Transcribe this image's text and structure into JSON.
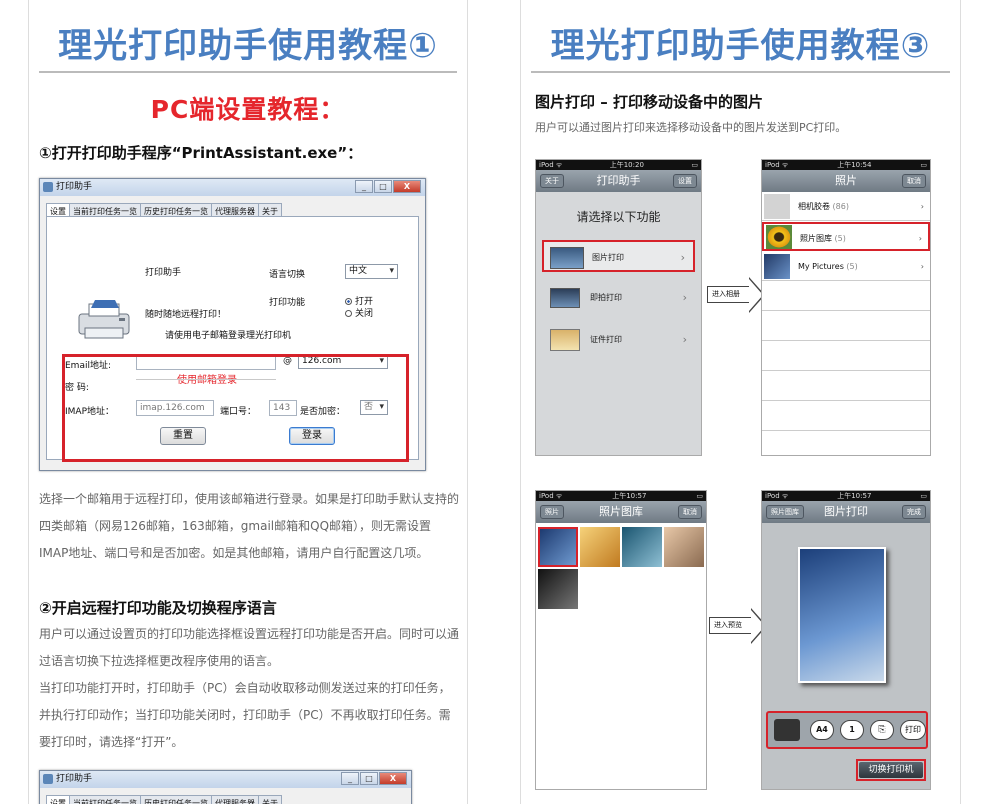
{
  "left": {
    "title": "理光打印助手使用教程①",
    "section_title": "PC端设置教程：",
    "step1": "①打开打印助手程序“PrintAssistant.exe”：",
    "dialog": {
      "window_title": "打印助手",
      "controls": [
        "_",
        "□",
        "X"
      ],
      "tabs": [
        "设置",
        "当前打印任务一览",
        "历史打印任务一览",
        "代理服务器",
        "关于"
      ],
      "app_name": "打印助手",
      "slogan": "随时随地远程打印！",
      "language_label": "语言切换",
      "language_value": "中文",
      "print_func_label": "打印功能",
      "radio_on": "打开",
      "radio_off": "关闭",
      "login_hint": "请使用电子邮箱登录理光打印机",
      "email_label": "Email地址:",
      "at": "@",
      "domain_value": "126.com",
      "annotation": "使用邮箱登录",
      "password_label": "密 码:",
      "imap_label": "IMAP地址：",
      "imap_value": "imap.126.com",
      "port_label": "端口号：",
      "port_value": "143",
      "encrypt_label": "是否加密：",
      "encrypt_value": "否",
      "reset_button": "重置",
      "login_button": "登录"
    },
    "para1": "选择一个邮箱用于远程打印，使用该邮箱进行登录。如果是打印助手默认支持的四类邮箱（网易126邮箱，163邮箱，gmail邮箱和QQ邮箱），则无需设置IMAP地址、端口号和是否加密。如是其他邮箱，请用户自行配置这几项。",
    "step2": "②开启远程打印功能及切换程序语言",
    "para2": "用户可以通过设置页的打印功能选择框设置远程打印功能是否开启。同时可以通过语言切换下拉选择框更改程序使用的语言。",
    "para3": "当打印功能打开时，打印助手（PC）会自动收取移动侧发送过来的打印任务，并执行打印动作；当打印功能关闭时，打印助手（PC）不再收取打印任务。需要打印时，请选择“打开”。",
    "dialog2": {
      "window_title": "打印助手",
      "controls": [
        "_",
        "□",
        "X"
      ],
      "tabs": [
        "设置",
        "当前打印任务一览",
        "历史打印任务一览",
        "代理服务器",
        "关于"
      ]
    }
  },
  "right": {
    "title": "理光打印助手使用教程③",
    "heading": "图片打印 – 打印移动设备中的图片",
    "desc": "用户可以通过图片打印来选择移动设备中的图片发送到PC打印。",
    "phone1": {
      "status_left": "iPod ᯤ",
      "status_time": "上午10:20",
      "nav_title": "打印助手",
      "nav_left": "关于",
      "nav_right": "设置",
      "prompt": "请选择以下功能",
      "items": [
        "图片打印",
        "即拍打印",
        "证件打印"
      ]
    },
    "arrow1": "进入相册",
    "phone2": {
      "status_left": "iPod ᯤ",
      "status_time": "上午10:54",
      "nav_title": "照片",
      "nav_right": "取消",
      "rows": [
        {
          "name": "相机胶卷",
          "count": "(86)"
        },
        {
          "name": "照片图库",
          "count": "(5)"
        },
        {
          "name": "My Pictures",
          "count": "(5)"
        }
      ]
    },
    "phone3": {
      "status_left": "iPod ᯤ",
      "status_time": "上午10:57",
      "nav_title": "照片图库",
      "nav_left": "照片",
      "nav_right": "取消"
    },
    "arrow2": "进入预览",
    "phone4": {
      "status_left": "iPod ᯤ",
      "status_time": "上午10:57",
      "nav_title": "图片打印",
      "nav_left": "照片图库",
      "nav_right": "完成",
      "toolbar": [
        "A4",
        "1",
        "打印"
      ],
      "switch_button": "切换打印机"
    }
  },
  "colors": {
    "title_blue": "#4a7fc1",
    "accent_red": "#e5262c"
  }
}
